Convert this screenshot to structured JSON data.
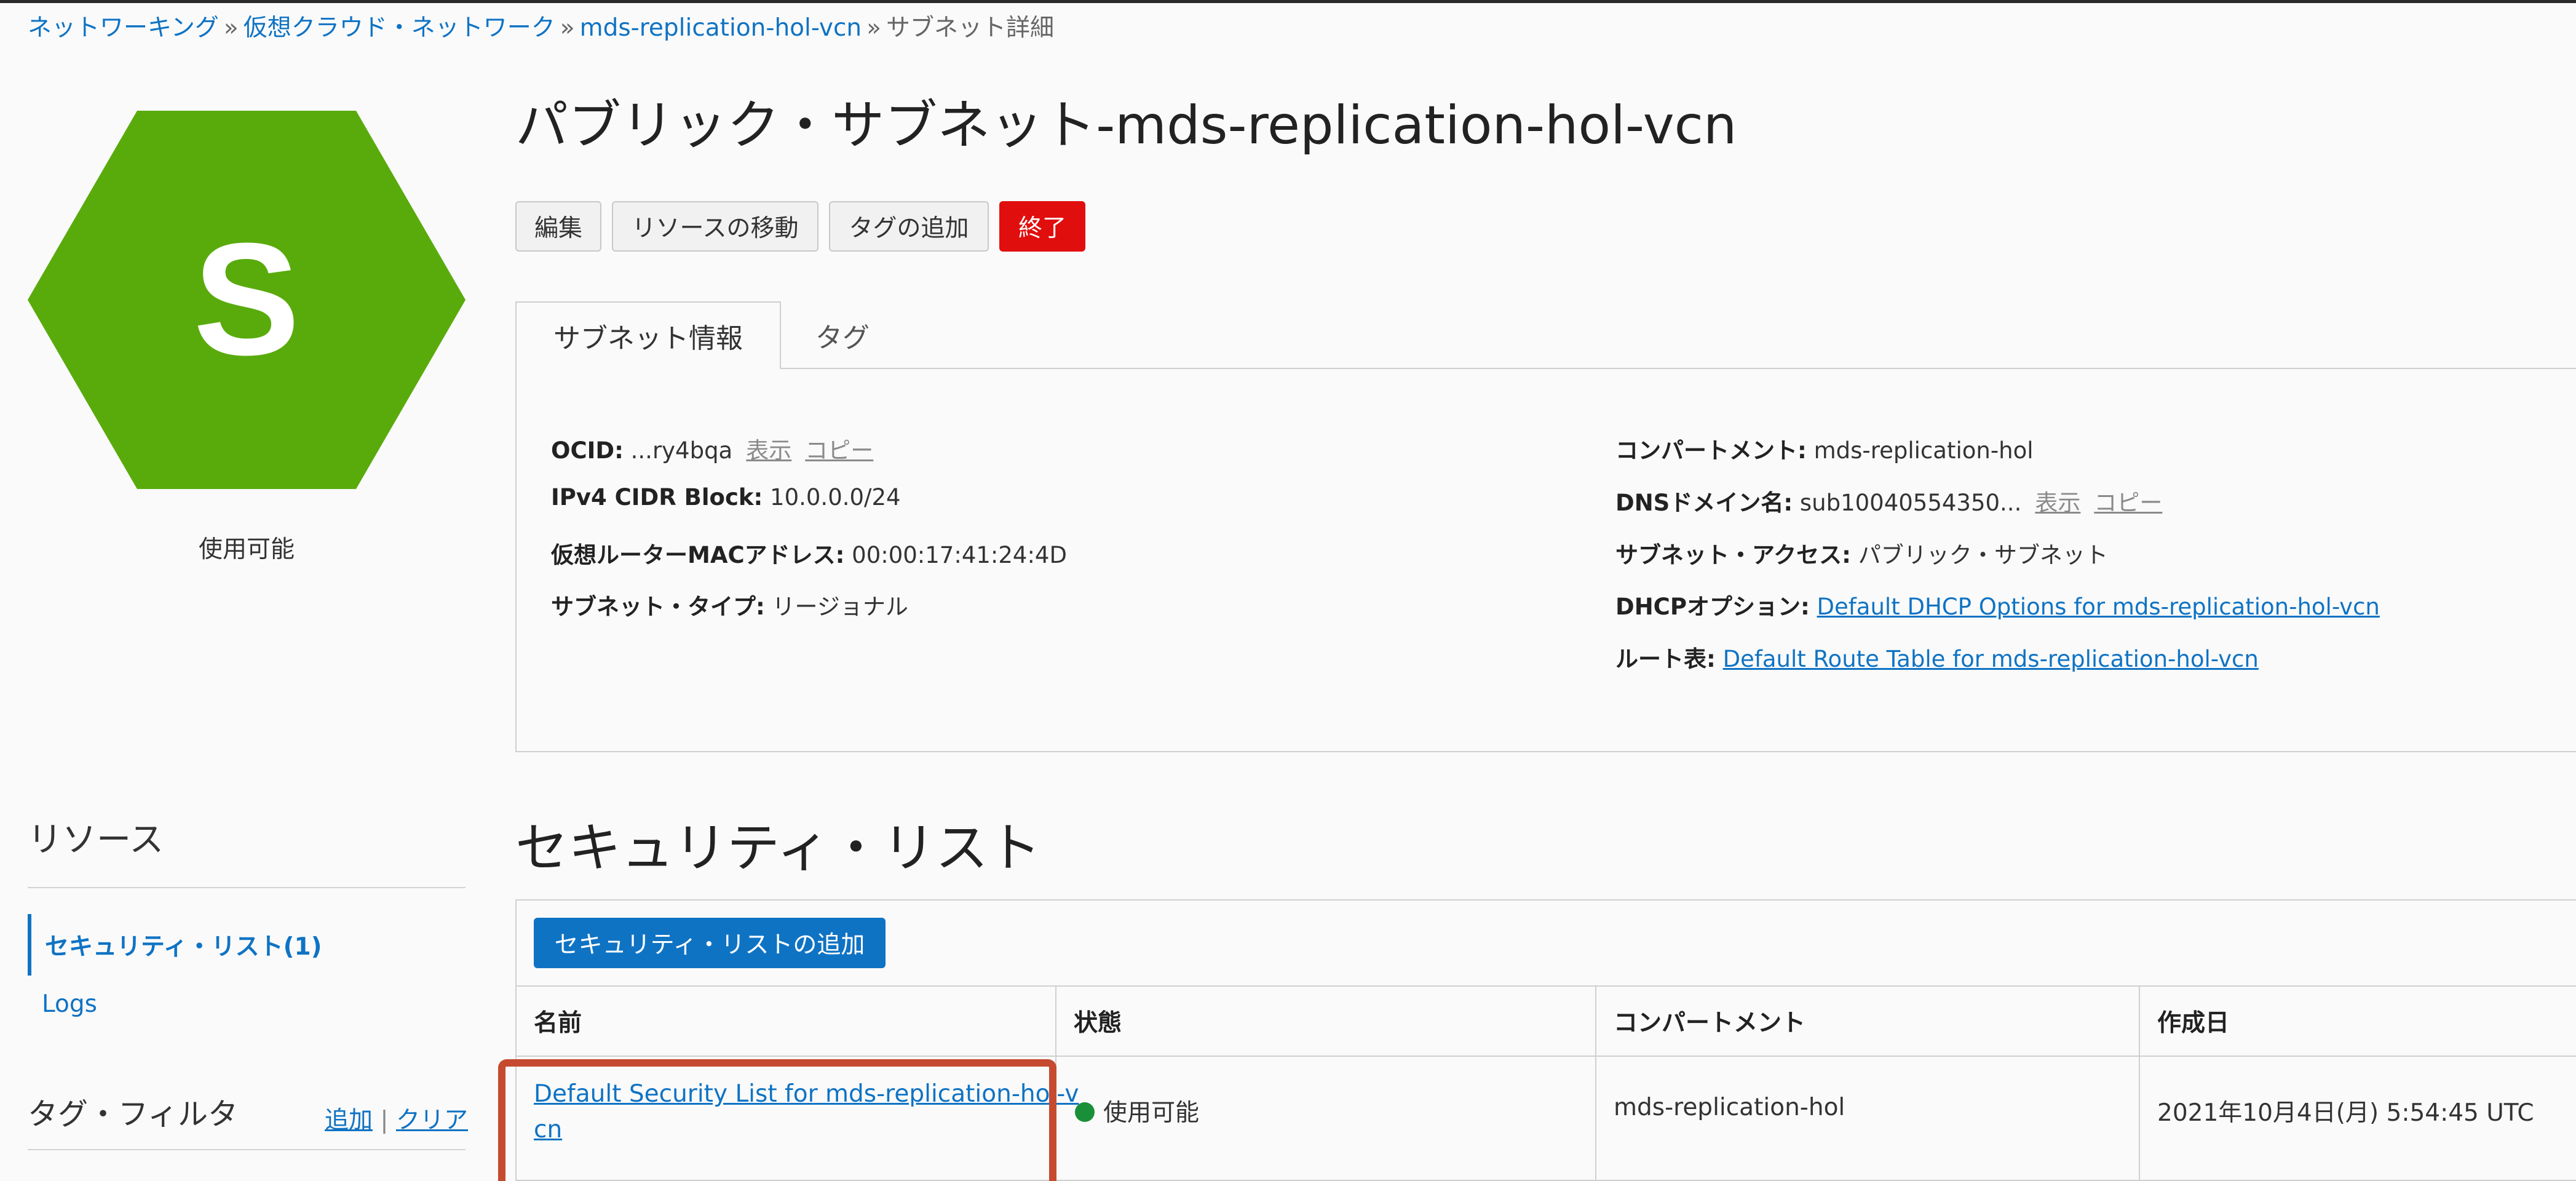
{
  "breadcrumb": {
    "items": [
      "ネットワーキング",
      "仮想クラウド・ネットワーク",
      "mds-replication-hol-vcn"
    ],
    "separator": "»",
    "current": "サブネット詳細"
  },
  "badge": {
    "letter": "S",
    "status": "使用可能",
    "color": "#59ab0c"
  },
  "title": "パブリック・サブネット-mds-replication-hol-vcn",
  "actions": {
    "edit": "編集",
    "move": "リソースの移動",
    "add_tag": "タグの追加",
    "terminate": "終了"
  },
  "tabs": {
    "info": "サブネット情報",
    "tags": "タグ"
  },
  "info_left": {
    "ocid_label": "OCID:",
    "ocid_value": "...ry4bqa",
    "show": "表示",
    "copy": "コピー",
    "cidr_label": "IPv4 CIDR Block:",
    "cidr_value": "10.0.0.0/24",
    "mac_label": "仮想ルーターMACアドレス:",
    "mac_value": "00:00:17:41:24:4D",
    "type_label": "サブネット・タイプ:",
    "type_value": "リージョナル"
  },
  "info_right": {
    "compartment_label": "コンパートメント:",
    "compartment_value": "mds-replication-hol",
    "dns_label": "DNSドメイン名:",
    "dns_value": "sub10040554350...",
    "show": "表示",
    "copy": "コピー",
    "access_label": "サブネット・アクセス:",
    "access_value": "パブリック・サブネット",
    "dhcp_label": "DHCPオプション:",
    "dhcp_value": "Default DHCP Options for mds-replication-hol-vcn",
    "route_label": "ルート表:",
    "route_value": "Default Route Table for mds-replication-hol-vcn"
  },
  "resources": {
    "title": "リソース",
    "active_item": "セキュリティ・リスト(1)",
    "item2": "Logs",
    "tag_filter": "タグ・フィルタ",
    "add": "追加",
    "pipe": "|",
    "clear": "クリア"
  },
  "security_list": {
    "title": "セキュリティ・リスト",
    "add_button": "セキュリティ・リストの追加",
    "columns": [
      "名前",
      "状態",
      "コンパートメント",
      "作成日"
    ],
    "row": {
      "name_line1": "Default Security List for mds-replication-hol-v",
      "name_line2": "cn",
      "state": "使用可能",
      "compartment": "mds-replication-hol",
      "created": "2021年10月4日(月) 5:54:45 UTC"
    }
  },
  "colors": {
    "link": "#0f73c4",
    "danger": "#e10e0e",
    "status_ok": "#1a8f3a",
    "highlight": "#c64a2f"
  }
}
